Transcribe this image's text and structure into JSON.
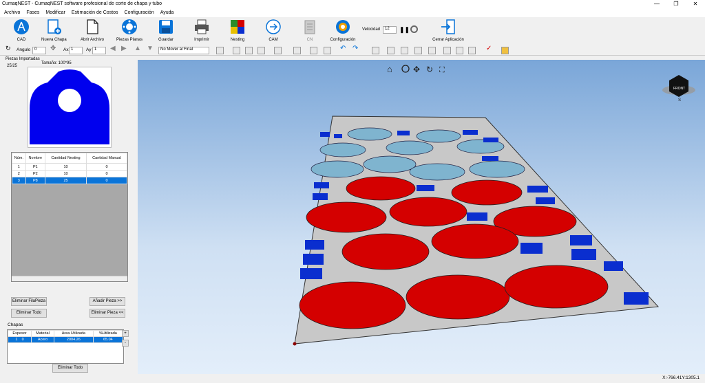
{
  "window": {
    "title": "CumaqNEST - CumaqNEST software profesional de corte de chapa y tubo"
  },
  "menu": [
    "Archivo",
    "Fases",
    "Modificar",
    "Estimación de Costos",
    "Configuración",
    "Ayuda"
  ],
  "ribbon": {
    "cad": "CAD",
    "nueva_chapa": "Nueva Chapa",
    "abrir": "Abrir Archivo",
    "piezas_planas": "Piezas Planas",
    "guardar": "Guardar",
    "imprimir": "Imprimir",
    "nesting": "Nesting",
    "cam": "CAM",
    "cn": "CN",
    "configuracion": "Configuración",
    "velocidad_label": "Velocidad",
    "velocidad_value": "12",
    "cerrar": "Cerrar Aplicación"
  },
  "toolbar2": {
    "angulo_label": "Angulo",
    "angulo_value": "0",
    "ax_label": "Ax",
    "ax_value": "1",
    "ay_label": "Ay",
    "ay_value": "1",
    "mover_value": "No Mover al Final"
  },
  "left": {
    "piezas_label": "Piezas Importadas",
    "count": "25/25",
    "tamano": "Tamaño: 100*95",
    "table_headers": [
      "Núm.",
      "Nombre",
      "Cantidad Nesting",
      "Cantidad Manual"
    ],
    "rows": [
      [
        "1",
        "P1",
        "10",
        "0"
      ],
      [
        "2",
        "P2",
        "10",
        "0"
      ],
      [
        "3",
        "P8",
        "25",
        "0"
      ]
    ],
    "btn_eliminar_fila": "Eliminar FilaPieza",
    "btn_anadir": "Añadir Pieza >>",
    "btn_eliminar_todo": "Eliminar Todo",
    "btn_eliminar_pieza": "Eliminar Pieza <<",
    "chapas_label": "Chapas",
    "chapas_headers": [
      "Espesor",
      "Material",
      "Area Utilizada",
      "%Utilizada"
    ],
    "chapas_rows": [
      [
        "1",
        "0",
        "Acero",
        "2004.26",
        "65.04"
      ]
    ],
    "btn_chapas_eliminar": "Eliminar Todo",
    "plus": "+",
    "minus": "-"
  },
  "viewport": {
    "cube_label": "FRONT",
    "compass_s": "S"
  },
  "status": {
    "coords": "X:-766.41Y:1305.1"
  },
  "colors": {
    "accent": "#0a74d8",
    "big_part": "#d40000",
    "light_part": "#7fb4cf",
    "small_part": "#0a2ecf"
  }
}
